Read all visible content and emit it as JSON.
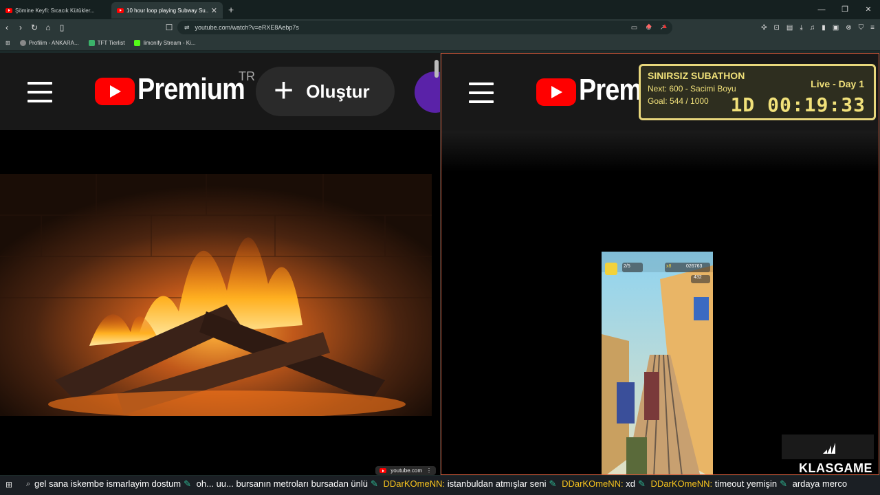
{
  "tabs": [
    {
      "title": "Şömine Keyfi: Sıcacık Kütükler...",
      "active": false
    },
    {
      "title": "10 hour loop playing Subway Su...",
      "active": true
    }
  ],
  "address": {
    "url": "youtube.com/watch?v=eRXE8Aebp7s"
  },
  "bookmarks": [
    {
      "label": "Profilim - ANKARA..."
    },
    {
      "label": "TFT Tierlist"
    },
    {
      "label": "limonify Stream - Ki..."
    }
  ],
  "left_pane": {
    "brand": "Premium",
    "region": "TR",
    "create_label": "Oluştur",
    "source_chip": "youtube.com"
  },
  "right_pane": {
    "brand": "Premium"
  },
  "overlay": {
    "title": "SINIRSIZ SUBATHON",
    "next": "Next: 600 - Sacimi Boyu",
    "goal": "Goal: 544 / 1000",
    "live": "Live - Day 1",
    "timer": "1D 00:19:33"
  },
  "game_hud": {
    "score": "026763",
    "coins": "432",
    "multiplier": "x8",
    "keys": "2/5"
  },
  "stream_brand": "KLASGAME",
  "chat": [
    {
      "user": "",
      "msg": "gel sana iskembe ismarlayim dostum"
    },
    {
      "user": "",
      "msg": "oh... uu... bursanın metroları bursadan ünlü"
    },
    {
      "user": "DDarKOmeNN:",
      "msg": "istanbuldan atmışlar seni"
    },
    {
      "user": "DDarKOmeNN:",
      "msg": "xd"
    },
    {
      "user": "DDarKOmeNN:",
      "msg": "timeout yemişin"
    },
    {
      "user": "",
      "msg": "ardaya merco"
    }
  ],
  "colors": {
    "accent": "#d4593a",
    "overlay": "#f1e17a",
    "yt_red": "#ff0000"
  }
}
